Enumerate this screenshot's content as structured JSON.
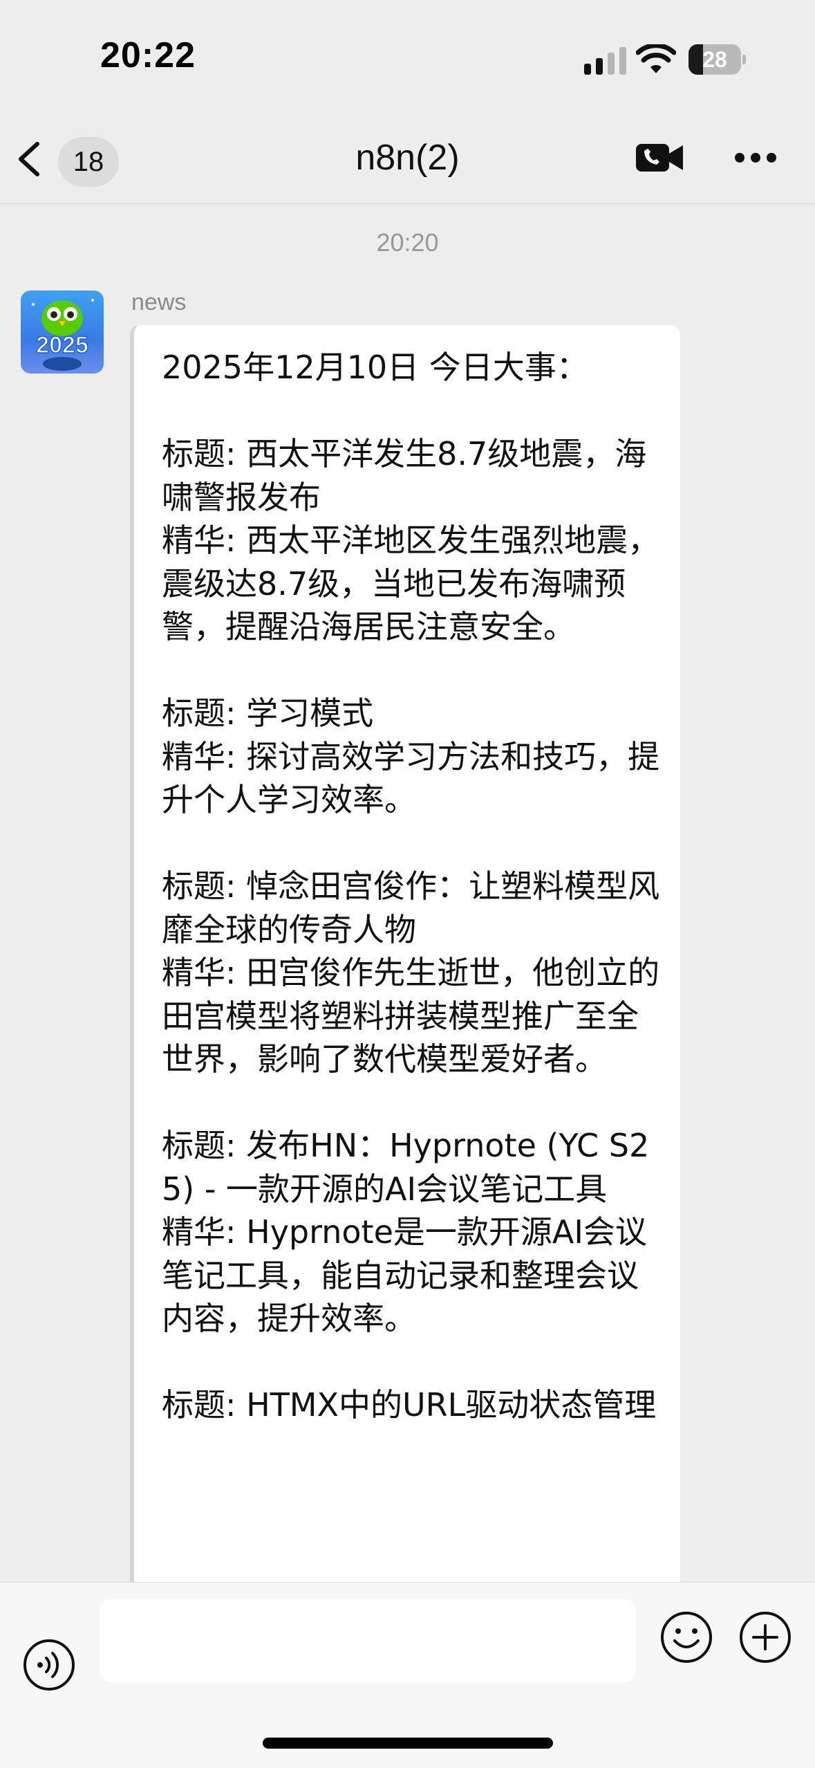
{
  "status_bar": {
    "time": "20:22",
    "battery_level": "28",
    "battery_fraction": 0.28
  },
  "nav": {
    "back_icon": "chevron-left-icon",
    "unread_count": "18",
    "title": "n8n(2)",
    "video_call_icon": "video-call-icon",
    "more_icon": "more-icon"
  },
  "messages": [
    {
      "timestamp": "20:20",
      "sender": "news",
      "avatar_text": "2025",
      "text": "2025年12月10日 今日大事：\n\n标题: 西太平洋发生8.7级地震，海啸警报发布\n精华: 西太平洋地区发生强烈地震，震级达8.7级，当地已发布海啸预警，提醒沿海居民注意安全。\n\n标题: 学习模式\n精华: 探讨高效学习方法和技巧，提升个人学习效率。\n\n标题: 悼念田宫俊作：让塑料模型风靡全球的传奇人物\n精华: 田宫俊作先生逝世，他创立的田宫模型将塑料拼装模型推广至全世界，影响了数代模型爱好者。\n\n标题: 发布HN：Hyprnote (YC S25) - 一款开源的AI会议笔记工具\n精华: Hyprnote是一款开源AI会议笔记工具，能自动记录和整理会议内容，提升效率。\n\n标题: HTMX中的URL驱动状态管理"
    }
  ],
  "input_bar": {
    "voice_icon": "voice-icon",
    "emoji_icon": "emoji-icon",
    "plus_icon": "plus-icon",
    "input_value": ""
  },
  "colors": {
    "background": "#ededed",
    "bubble": "#ffffff",
    "input_bar": "#f7f7f7"
  }
}
